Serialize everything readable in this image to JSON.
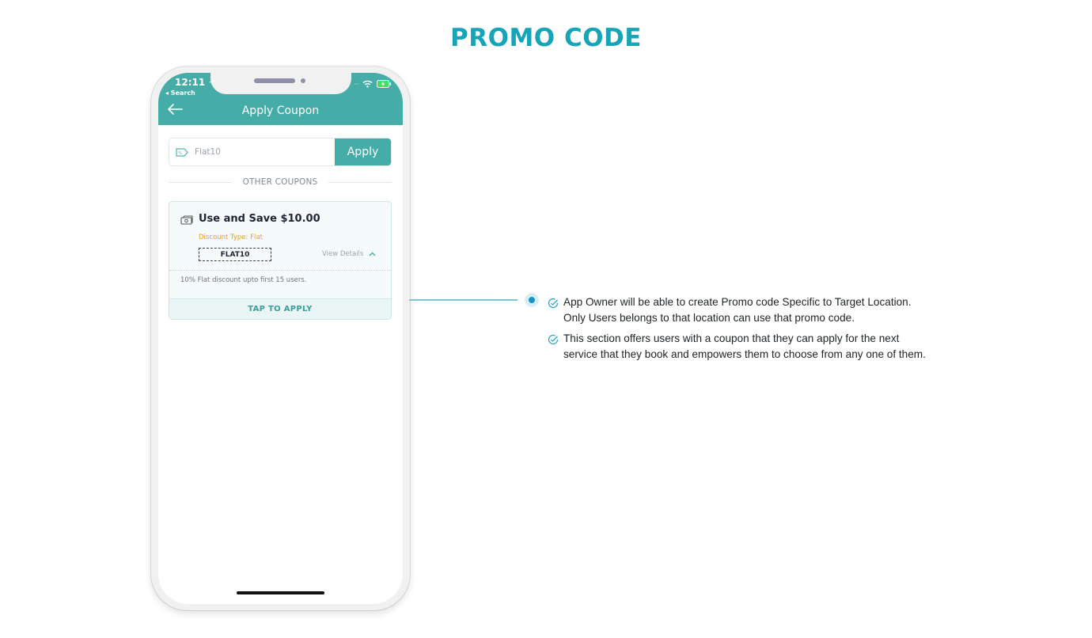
{
  "page": {
    "title": "PROMO CODE"
  },
  "colors": {
    "accent": "#45aca8",
    "title": "#16a5b8",
    "discount_type": "#e8a21b",
    "connector": "#7fc3d6",
    "connector_dot": "#1596c4"
  },
  "phone": {
    "status_bar": {
      "time": "12:11",
      "back_label": "◂ Search",
      "icons": [
        "location-arrow-icon",
        "wifi-icon",
        "battery-charging-icon"
      ]
    },
    "header": {
      "title": "Apply Coupon",
      "back_icon": "arrow-left-icon"
    },
    "coupon_input": {
      "value": "Flat10",
      "icon": "coupon-tag-icon",
      "apply_label": "Apply"
    },
    "other_coupons_label": "OTHER COUPONS",
    "coupons": [
      {
        "icon": "cash-icon",
        "title": "Use and Save $10.00",
        "discount_type": "Discount Type: Flat",
        "code": "FLAT10",
        "view_details_label": "View Details",
        "description": "10% Flat discount upto first 15 users.",
        "tap_to_apply_label": "TAP TO APPLY"
      }
    ]
  },
  "features": [
    {
      "icon": "check-circle-icon",
      "text": "App Owner will be able to create Promo code Specific to Target Location. Only Users belongs to that location can use that promo code."
    },
    {
      "icon": "check-circle-icon",
      "text": "This section offers users with a coupon that they can apply for the next service that they book and empowers them to choose from any one of them."
    }
  ]
}
